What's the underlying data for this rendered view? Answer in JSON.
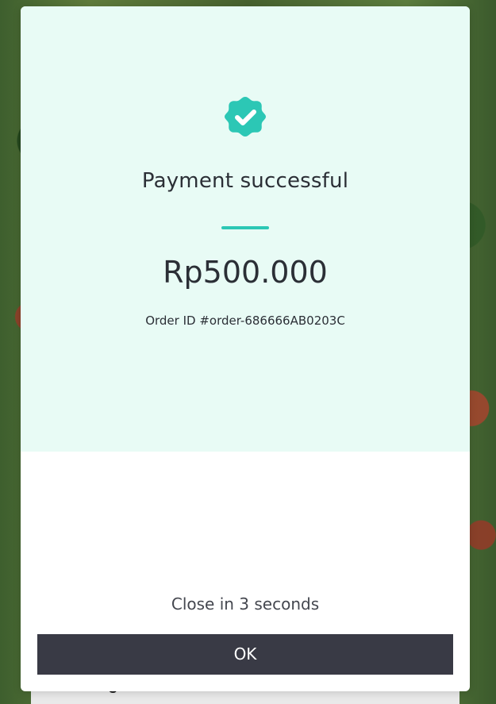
{
  "modal": {
    "title": "Payment successful",
    "amount": "Rp500.000",
    "order_id": "Order ID #order-686666AB0203C",
    "close_text": "Close in 3 seconds",
    "ok_button_label": "OK",
    "icon": "verified-check-badge-icon",
    "accent_color": "#2cc7b5",
    "panel_color": "#e8fbf5",
    "button_color": "#393a45"
  },
  "background": {
    "partial_label": "Harga"
  }
}
